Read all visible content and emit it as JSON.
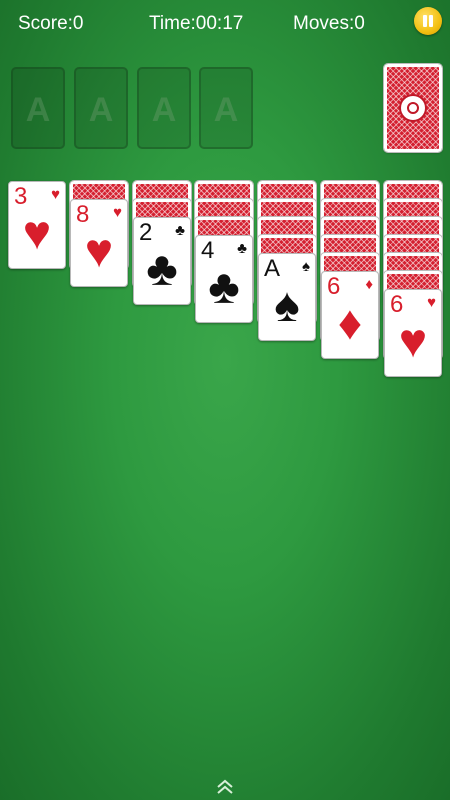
{
  "hud": {
    "score": "Score:0",
    "time": "Time:00:17",
    "moves": "Moves:0"
  },
  "foundations": [
    "A",
    "A",
    "A",
    "A"
  ],
  "tableau": [
    {
      "rank": "3",
      "suit": "♥",
      "color": "red"
    },
    {
      "rank": "8",
      "suit": "♥",
      "color": "red"
    },
    {
      "rank": "2",
      "suit": "♣",
      "color": "black"
    },
    {
      "rank": "4",
      "suit": "♣",
      "color": "black"
    },
    {
      "rank": "A",
      "suit": "♠",
      "color": "black"
    },
    {
      "rank": "6",
      "suit": "♦",
      "color": "red"
    },
    {
      "rank": "6",
      "suit": "♥",
      "color": "red"
    }
  ],
  "colors": {
    "felt": "#2e9a40",
    "card_red": "#d81e2c",
    "card_back": "#d42030",
    "pause": "#f3c012"
  },
  "icons": {
    "pause": "pause-icon",
    "expand": "chevron-up-icon"
  }
}
